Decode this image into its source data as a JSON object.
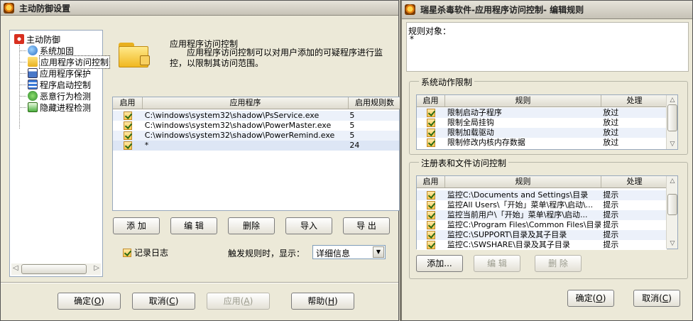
{
  "left_window": {
    "title": "主动防御设置",
    "tree": {
      "root": "主动防御",
      "items": [
        "系统加固",
        "应用程序访问控制",
        "应用程序保护",
        "程序启动控制",
        "恶意行为检测",
        "隐藏进程检测"
      ],
      "selected_index": 1
    },
    "header": {
      "title": "应用程序访问控制",
      "description": "应用程序访问控制可以对用户添加的可疑程序进行监控，以限制其访问范围。"
    },
    "table": {
      "columns": [
        "启用",
        "应用程序",
        "启用规则数"
      ],
      "rows": [
        {
          "app": "C:\\windows\\system32\\shadow\\PsService.exe",
          "count": "5"
        },
        {
          "app": "C:\\windows\\system32\\shadow\\PowerMaster.exe",
          "count": "5"
        },
        {
          "app": "C:\\windows\\system32\\shadow\\PowerRemind.exe",
          "count": "5"
        },
        {
          "app": "*",
          "count": "24"
        }
      ]
    },
    "actions": [
      "添 加",
      "编 辑",
      "删除",
      "导入",
      "导 出"
    ],
    "log_checkbox": "记录日志",
    "trigger_label": "触发规则时，显示：",
    "trigger_select": "详细信息",
    "bottom": {
      "ok": {
        "label": "确定(",
        "key": "O",
        "tail": ")"
      },
      "cancel": {
        "label": "取消(",
        "key": "C",
        "tail": ")"
      },
      "apply": {
        "label": "应用(",
        "key": "A",
        "tail": ")"
      },
      "help": {
        "label": "帮助(",
        "key": "H",
        "tail": ")"
      }
    }
  },
  "right_window": {
    "title": "瑞星杀毒软件-应用程序访问控制- 编辑规则",
    "rule_object_label": "规则对象：",
    "rule_object_value": "*",
    "system_group": {
      "label": "系统动作限制",
      "columns": [
        "启用",
        "规则",
        "处理"
      ],
      "rows": [
        {
          "rule": "限制启动子程序",
          "action": "放过"
        },
        {
          "rule": "限制全局挂钩",
          "action": "放过"
        },
        {
          "rule": "限制加载驱动",
          "action": "放过"
        },
        {
          "rule": "限制修改内核内存数据",
          "action": "放过"
        }
      ]
    },
    "registry_group": {
      "label": "注册表和文件访问控制",
      "columns": [
        "启用",
        "规则",
        "处理"
      ],
      "rows": [
        {
          "rule": "监控C:\\Documents and Settings\\目录",
          "action": "提示"
        },
        {
          "rule": "监控All Users\\「开始」菜单\\程序\\启动\\...",
          "action": "提示"
        },
        {
          "rule": "监控当前用户\\「开始」菜单\\程序\\启动...",
          "action": "提示"
        },
        {
          "rule": "监控C:\\Program Files\\Common Files\\目录",
          "action": "提示"
        },
        {
          "rule": "监控C:\\SUPPORT\\目录及其子目录",
          "action": "提示"
        },
        {
          "rule": "监控C:\\SWSHARE\\目录及其子目录",
          "action": "提示"
        }
      ]
    },
    "group_buttons": [
      "添加...",
      "编 辑",
      "删 除"
    ],
    "bottom": {
      "ok": {
        "label": "确定(",
        "key": "O",
        "tail": ")"
      },
      "cancel": {
        "label": "取消(",
        "key": "C",
        "tail": ")"
      }
    }
  }
}
